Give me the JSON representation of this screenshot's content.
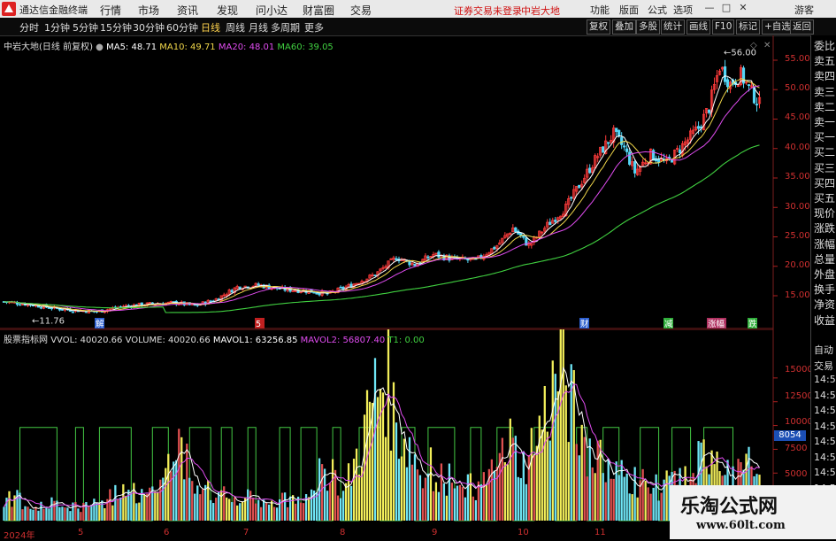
{
  "titlebar": {
    "app_name": "通达信金融终端",
    "menus": [
      "行情",
      "市场",
      "资讯",
      "发现",
      "问小达",
      "财富圈",
      "交易"
    ],
    "login_status": "证券交易未登录",
    "stock_name": "中岩大地",
    "right_menus": [
      "功能",
      "版面",
      "公式",
      "选项"
    ],
    "guest": "游客",
    "minimize": "—",
    "maximize": "□",
    "close": "✕"
  },
  "periods": {
    "items": [
      "分时",
      "1分钟",
      "5分钟",
      "15分钟",
      "30分钟",
      "60分钟",
      "日线",
      "周线",
      "月线",
      "多周期",
      "更多"
    ],
    "active": "日线",
    "right_buttons": [
      "复权",
      "叠加",
      "多股",
      "统计",
      "画线",
      "F10",
      "标记",
      "+自选",
      "返回"
    ]
  },
  "main_legend": {
    "name": "中岩大地(日线 前复权)",
    "ma5": "MA5: 48.71",
    "ma10": "MA10: 49.71",
    "ma20": "MA20: 48.01",
    "ma60": "MA60: 39.05"
  },
  "vol_legend": {
    "indicator": "股票指标网",
    "vvol": "VVOL: 40020.66",
    "volume": "VOLUME: 40020.66",
    "mavol1": "MAVOL1: 63256.85",
    "mavol2": "MAVOL2: 56807.40",
    "t1": "T1: 0.00"
  },
  "price_axis": [
    "55.00",
    "50.00",
    "45.00",
    "40.00",
    "35.00",
    "30.00",
    "25.00",
    "20.00",
    "15.00"
  ],
  "volume_axis": [
    "15000",
    "12500",
    "10000",
    "7500",
    "5000"
  ],
  "volume_marker": "8054",
  "x_axis": [
    "2024年",
    "5",
    "6",
    "7",
    "8",
    "9",
    "10",
    "11"
  ],
  "annotations": {
    "high": "56.00",
    "low": "11.76",
    "events": [
      "解",
      "5",
      "财",
      "减",
      "涨幅",
      "跌"
    ]
  },
  "side_panel": {
    "upper": [
      "委比",
      "卖五",
      "卖四",
      "卖三",
      "卖二",
      "卖一",
      "买一",
      "买二",
      "买三",
      "买四",
      "买五",
      "现价",
      "涨跌",
      "涨幅",
      "总量",
      "外盘",
      "换手",
      "净资",
      "收益"
    ],
    "lower": [
      "自动",
      "交易",
      "14:5",
      "14:5",
      "14:5",
      "14:5",
      "14:5",
      "14:5",
      "14:5",
      "14:5"
    ]
  },
  "watermark": {
    "title": "乐淘公式网",
    "url": "www.60lt.com"
  },
  "colors": {
    "up": "#ff3b3b",
    "down": "#54d6f6",
    "ma5": "#ffffff",
    "ma10": "#f1d74a",
    "ma20": "#e04cf0",
    "ma60": "#40d040",
    "volume_yellow": "#f2ee5a",
    "volume_cyan": "#6fe6f6",
    "volume_red": "#e05050",
    "t1_green": "#44c844",
    "axis_text": "#d03030"
  },
  "chart_data": {
    "type": "candlestick",
    "price_range": [
      11.0,
      58.0
    ],
    "high_label": 56.0,
    "low_label": 11.76,
    "current": {
      "ma5": 48.71,
      "ma10": 49.71,
      "ma20": 48.01,
      "ma60": 39.05
    },
    "close_keypoints": [
      [
        0,
        14.0
      ],
      [
        10,
        13.5
      ],
      [
        20,
        12.8
      ],
      [
        25,
        12.6
      ],
      [
        35,
        12.3
      ],
      [
        45,
        13.2
      ],
      [
        55,
        13.6
      ],
      [
        65,
        13.8
      ],
      [
        72,
        13.3
      ],
      [
        80,
        14.4
      ],
      [
        88,
        16.5
      ],
      [
        96,
        16.8
      ],
      [
        105,
        16.1
      ],
      [
        115,
        15.8
      ],
      [
        122,
        15.3
      ],
      [
        130,
        16.6
      ],
      [
        140,
        18.6
      ],
      [
        148,
        21.5
      ],
      [
        155,
        20.3
      ],
      [
        162,
        22.0
      ],
      [
        170,
        21.2
      ],
      [
        178,
        21.0
      ],
      [
        186,
        23.5
      ],
      [
        192,
        26.5
      ],
      [
        198,
        23.5
      ],
      [
        205,
        27.0
      ],
      [
        212,
        30.0
      ],
      [
        218,
        34.5
      ],
      [
        224,
        38.8
      ],
      [
        230,
        42.5
      ],
      [
        234,
        40.0
      ],
      [
        238,
        36.0
      ],
      [
        244,
        39.0
      ],
      [
        250,
        37.5
      ],
      [
        256,
        40.5
      ],
      [
        262,
        43.5
      ],
      [
        266,
        47.0
      ],
      [
        270,
        54.0
      ],
      [
        274,
        51.0
      ],
      [
        278,
        52.5
      ],
      [
        282,
        49.5
      ],
      [
        285,
        47.5
      ]
    ],
    "volume_range": [
      0,
      17500
    ],
    "volume_keypoints": [
      [
        0,
        2500
      ],
      [
        15,
        1800
      ],
      [
        30,
        1600
      ],
      [
        40,
        2500
      ],
      [
        50,
        3000
      ],
      [
        60,
        4500
      ],
      [
        66,
        7500
      ],
      [
        70,
        5000
      ],
      [
        80,
        2600
      ],
      [
        95,
        2200
      ],
      [
        110,
        2000
      ],
      [
        118,
        4500
      ],
      [
        124,
        6000
      ],
      [
        128,
        2800
      ],
      [
        134,
        7500
      ],
      [
        140,
        13500
      ],
      [
        144,
        15500
      ],
      [
        148,
        10000
      ],
      [
        156,
        6500
      ],
      [
        164,
        5000
      ],
      [
        172,
        3500
      ],
      [
        180,
        3500
      ],
      [
        186,
        5500
      ],
      [
        190,
        8500
      ],
      [
        196,
        5800
      ],
      [
        202,
        9800
      ],
      [
        207,
        13500
      ],
      [
        210,
        17000
      ],
      [
        214,
        12000
      ],
      [
        220,
        7800
      ],
      [
        228,
        5200
      ],
      [
        236,
        4500
      ],
      [
        246,
        3600
      ],
      [
        256,
        4000
      ],
      [
        262,
        6000
      ],
      [
        268,
        8500
      ],
      [
        274,
        3800
      ],
      [
        280,
        5600
      ],
      [
        285,
        5800
      ]
    ],
    "t1_pattern": "step signal 0/1"
  }
}
